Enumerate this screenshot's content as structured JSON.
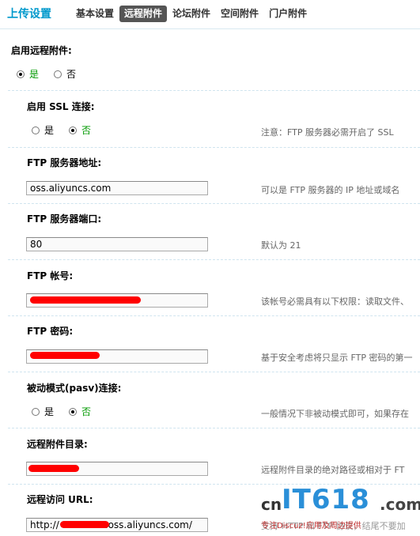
{
  "header": {
    "title": "上传设置",
    "tabs": [
      {
        "label": "基本设置",
        "active": false
      },
      {
        "label": "远程附件",
        "active": true
      },
      {
        "label": "论坛附件",
        "active": false
      },
      {
        "label": "空间附件",
        "active": false
      },
      {
        "label": "门户附件",
        "active": false
      }
    ]
  },
  "settings": {
    "enable_remote": {
      "label": "启用远程附件:",
      "yes": "是",
      "no": "否",
      "selected": "yes"
    },
    "ssl": {
      "label": "启用 SSL 连接:",
      "yes": "是",
      "no": "否",
      "selected": "no",
      "hint": "注意：FTP 服务器必需开启了 SSL"
    },
    "ftp_host": {
      "label": "FTP 服务器地址:",
      "value": "oss.aliyuncs.com",
      "hint": "可以是 FTP 服务器的 IP 地址或域名"
    },
    "ftp_port": {
      "label": "FTP 服务器端口:",
      "value": "80",
      "hint": "默认为 21"
    },
    "ftp_account": {
      "label": "FTP 帐号:",
      "value": "",
      "hint": "该帐号必需具有以下权限：读取文件、"
    },
    "ftp_password": {
      "label": "FTP 密码:",
      "value": "",
      "hint": "基于安全考虑将只显示 FTP 密码的第一"
    },
    "pasv": {
      "label": "被动模式(pasv)连接:",
      "yes": "是",
      "no": "否",
      "selected": "no",
      "hint": "一般情况下非被动模式即可，如果存在"
    },
    "remote_dir": {
      "label": "远程附件目录:",
      "value": "",
      "hint": "远程附件目录的绝对路径或相对于 FT"
    },
    "remote_url": {
      "label": "远程访问 URL:",
      "value": "http://",
      "value_suffix": ".oss.aliyuncs.com/",
      "hint": "支持 HTTP 和 FTP 协议，结尾不要加"
    }
  },
  "watermark": {
    "cn": "cn",
    "brand": "IT618",
    "suffix": ".com",
    "tagline": "专注Discuz!应用及周边提供"
  },
  "colors": {
    "accent": "#0099cc",
    "active_tab_bg": "#555555",
    "radio_on": "#009900",
    "redaction": "#ff0000"
  }
}
